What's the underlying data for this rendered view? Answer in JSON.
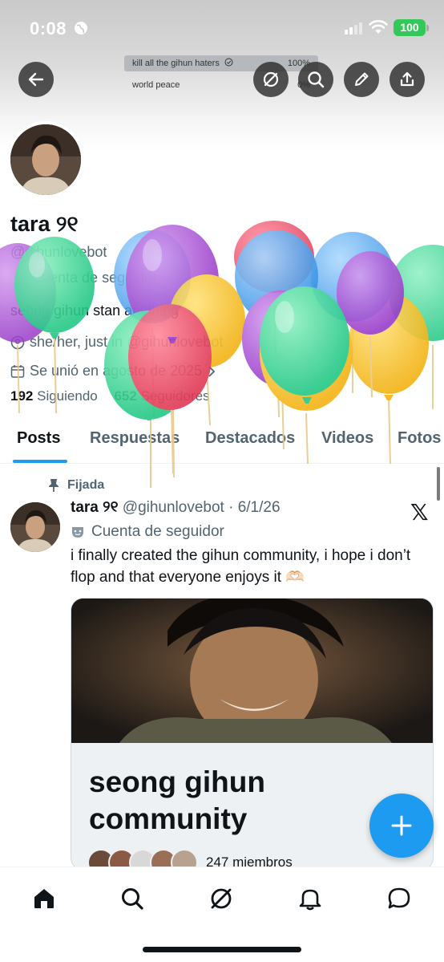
{
  "status_bar": {
    "time": "0:08",
    "battery": "100"
  },
  "header": {
    "back_icon": "arrow-left-icon",
    "buttons": [
      "grok-icon",
      "search-icon",
      "pencil-icon",
      "share-icon"
    ]
  },
  "poll": {
    "options": [
      {
        "label": "kill all the gihun haters",
        "percent": "100%",
        "fill": 1.0
      },
      {
        "label": "world peace",
        "percent": "0%",
        "fill": 0.0
      }
    ]
  },
  "profile": {
    "name": "tara ୨୧",
    "handle": "@gihunlovebot",
    "account_type": "Cuenta de seguidor",
    "bio": "seong gihun stan anything",
    "pronouns": "she/her, just in @gihunlovebot",
    "joined": "Se unió en agosto de 2025",
    "following_count": "192",
    "following_label": "Siguiendo",
    "followers_count": "652",
    "followers_label": "Seguidores"
  },
  "tabs": [
    "Posts",
    "Respuestas",
    "Destacados",
    "Videos",
    "Fotos"
  ],
  "post": {
    "pinned_label": "Fijada",
    "author": "tara ୨୧",
    "handle_date": "@gihunlovebot · 6/1/26",
    "account_type": "Cuenta de seguidor",
    "text": "i finally created the gihun community, i hope i don’t flop and that everyone enjoys it 🫶🏻",
    "card": {
      "title": "seong gihun community",
      "members": "247 miembros"
    }
  },
  "fab_label": "+",
  "colors": {
    "accent": "#1d9bf0",
    "text": "#0f1419",
    "muted": "#536471"
  },
  "bottom_nav": [
    "home-icon",
    "search-icon",
    "grok-icon",
    "bell-icon",
    "message-icon"
  ]
}
